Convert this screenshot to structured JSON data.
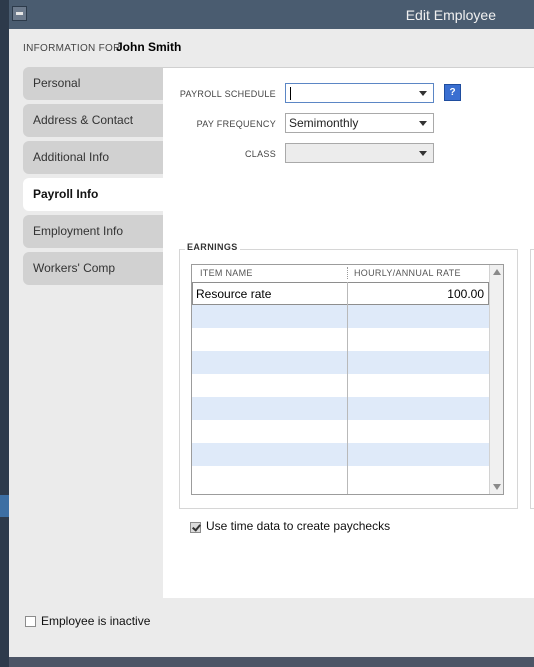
{
  "window": {
    "title": "Edit Employee"
  },
  "header": {
    "info_label": "INFORMATION FOR",
    "employee_name": "John Smith"
  },
  "tabs": [
    {
      "label": "Personal"
    },
    {
      "label": "Address & Contact"
    },
    {
      "label": "Additional Info"
    },
    {
      "label": "Payroll Info",
      "active": true
    },
    {
      "label": "Employment Info"
    },
    {
      "label": "Workers' Comp"
    }
  ],
  "payroll": {
    "schedule_label": "PAYROLL SCHEDULE",
    "schedule_value": "",
    "frequency_label": "PAY FREQUENCY",
    "frequency_value": "Semimonthly",
    "class_label": "CLASS",
    "class_value": "",
    "help": "?"
  },
  "earnings": {
    "section_label": "EARNINGS",
    "columns": [
      "ITEM NAME",
      "HOURLY/ANNUAL RATE"
    ],
    "rows": [
      {
        "item": "Resource rate",
        "rate": "100.00"
      }
    ]
  },
  "options": {
    "use_time_data_label": "Use time data to create paychecks",
    "use_time_data_checked": true
  },
  "footer": {
    "inactive_label": "Employee is inactive",
    "inactive_checked": false
  }
}
